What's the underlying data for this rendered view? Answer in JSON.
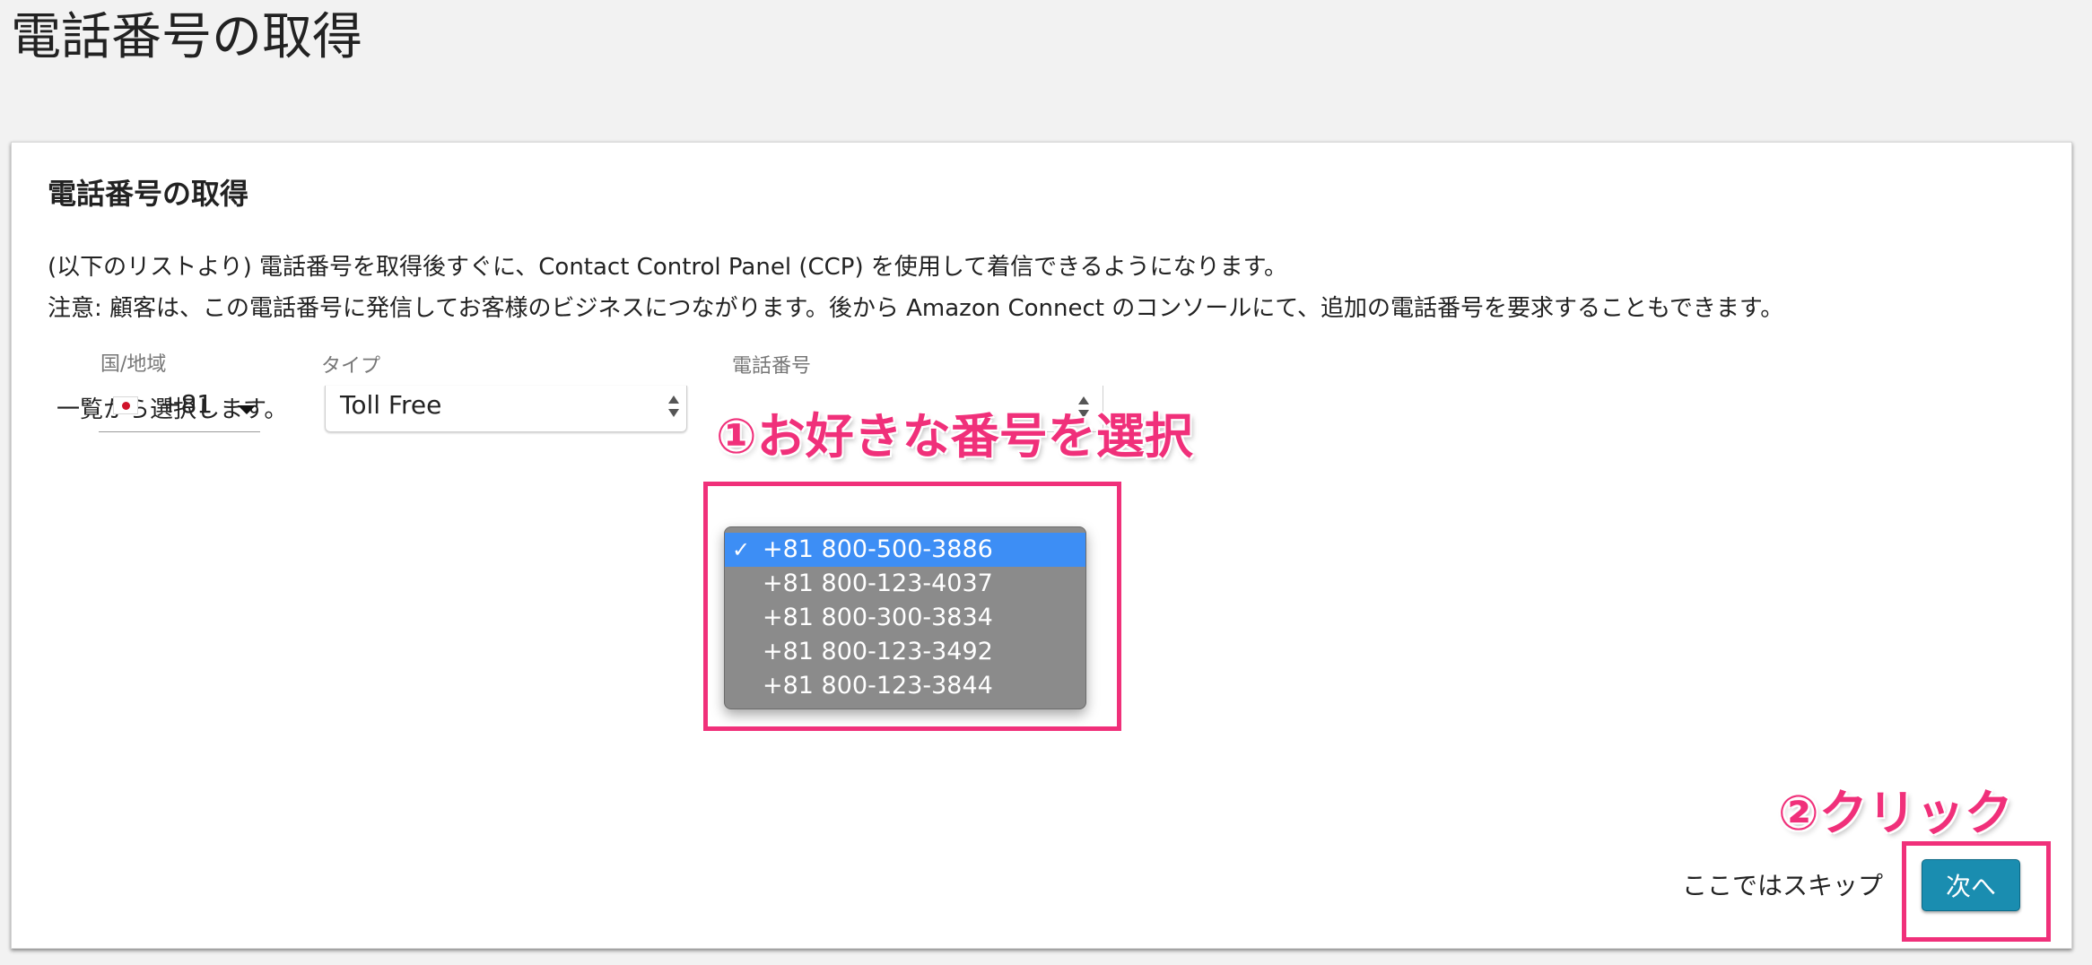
{
  "page": {
    "title": "電話番号の取得"
  },
  "card": {
    "title": "電話番号の取得",
    "description_line1": "(以下のリストより) 電話番号を取得後すぐに、Contact Control Panel (CCP) を使用して着信できるようになります。",
    "description_line2": "注意: 顧客は、この電話番号に発信してお客様のビジネスにつながります。後から Amazon Connect のコンソールにて、追加の電話番号を要求することもできます。",
    "select_prompt": "一覧から選択します。"
  },
  "form": {
    "country": {
      "label": "国/地域",
      "flag_icon": "japan-flag-icon",
      "value": "+81"
    },
    "type": {
      "label": "タイプ",
      "value": "Toll Free"
    },
    "phone_number": {
      "label": "電話番号",
      "options": [
        "+81 800-500-3886",
        "+81 800-123-4037",
        "+81 800-300-3834",
        "+81 800-123-3492",
        "+81 800-123-3844"
      ],
      "selected_index": 0,
      "check_mark": "✓"
    }
  },
  "annotations": {
    "step1": "①お好きな番号を選択",
    "step2": "②クリック",
    "color": "#f0307a"
  },
  "actions": {
    "skip_label": "ここではスキップ",
    "next_label": "次へ",
    "next_color": "#1a8db0"
  }
}
